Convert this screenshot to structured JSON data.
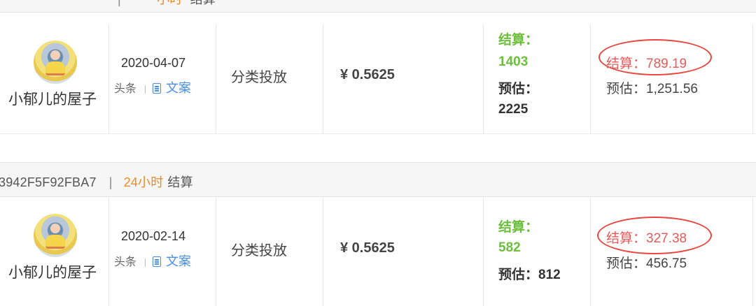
{
  "top_strip": {
    "prefix": "",
    "separator": "|",
    "period": "小时",
    "status": "结算"
  },
  "mid_strip": {
    "order_id": "3942F5F92FBA7",
    "separator": "|",
    "period": "24小时",
    "status": "结算"
  },
  "rows": [
    {
      "account": "小郁儿的屋子",
      "date": "2020-04-07",
      "platform": "头条",
      "content_type": "文案",
      "category": "分类投放",
      "unit_price": "¥ 0.5625",
      "count_settled_label": "结算：",
      "count_settled": "1403",
      "count_est_label": "预估：",
      "count_est": "2225",
      "amount_settled": "结算：789.19",
      "amount_est": "预估：1,251.56"
    },
    {
      "account": "小郁儿的屋子",
      "date": "2020-02-14",
      "platform": "头条",
      "content_type": "文案",
      "category": "分类投放",
      "unit_price": "¥ 0.5625",
      "count_settled_label": "结算：",
      "count_settled": "582",
      "count_est_label": "预估：812",
      "amount_settled": "结算：327.38",
      "amount_est": "预估：456.75"
    }
  ],
  "colors": {
    "settled_green": "#6bbf3b",
    "highlight_red": "#e8463f",
    "link_blue": "#4a90e2",
    "period_orange": "#f08a24"
  },
  "icons": [
    "avatar",
    "document-icon",
    "highlight-ellipse"
  ]
}
